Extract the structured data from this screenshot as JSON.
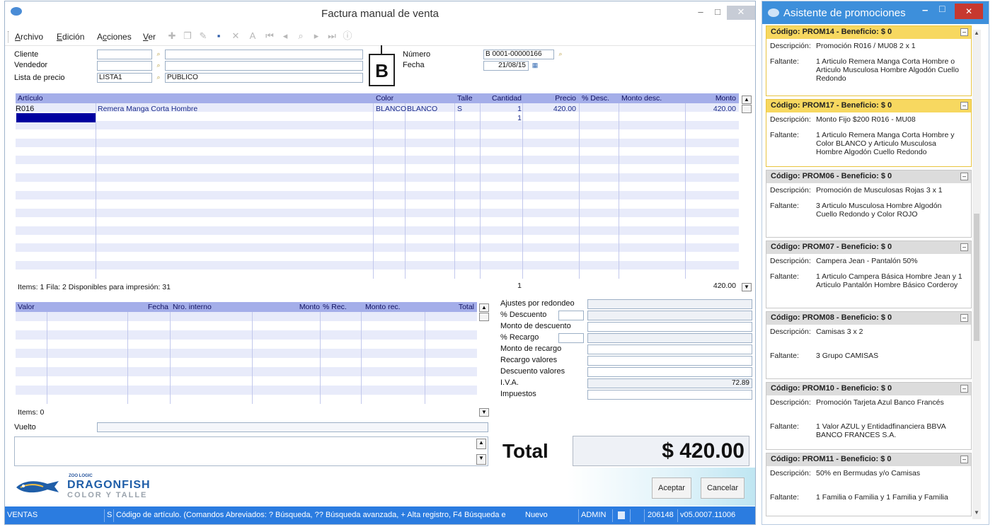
{
  "window": {
    "title": "Factura manual de venta",
    "minimize": "–",
    "maximize": "□",
    "close": "✕"
  },
  "menu": [
    {
      "label": "Archivo",
      "u": "A"
    },
    {
      "label": "Edición",
      "u": "E"
    },
    {
      "label": "Acciones",
      "u": "c"
    },
    {
      "label": "Ver",
      "u": "V"
    }
  ],
  "toolbar_icons": [
    "add-icon",
    "copy-icon",
    "edit-icon",
    "save-icon",
    "delete-icon",
    "font-icon",
    "first-icon",
    "prev-icon",
    "search-icon",
    "next-icon",
    "last-icon",
    "info-icon"
  ],
  "header": {
    "cliente_label": "Cliente",
    "vendedor_label": "Vendedor",
    "lista_label": "Lista de precio",
    "lista_code": "LISTA1",
    "lista_desc": "PUBLICO",
    "comprobante_letter": "B",
    "numero_label": "Número",
    "numero_value": "B 0001-00000166",
    "fecha_label": "Fecha",
    "fecha_value": "21/08/15"
  },
  "items_grid": {
    "columns": [
      "Artículo",
      "Color",
      "Talle",
      "Cantidad",
      "Precio",
      "% Desc.",
      "Monto desc.",
      "Monto"
    ],
    "rows": [
      {
        "articulo": "R016",
        "descripcion": "Remera Manga Corta Hombre",
        "color": "BLANCO",
        "color_desc": "BLANCO",
        "talle": "S",
        "cantidad": "1",
        "precio": "420.00",
        "monto": "420.00"
      },
      {
        "articulo": "",
        "descripcion": "",
        "color": "",
        "color_desc": "",
        "talle": "",
        "cantidad": "1",
        "precio": "",
        "monto": ""
      }
    ],
    "footer_info": "Items: 1   Fila: 2   Disponibles para impresión: 31",
    "footer_cantidad": "1",
    "footer_monto": "420.00"
  },
  "valores_grid": {
    "columns": [
      "Valor",
      "Fecha",
      "Nro. interno",
      "Monto",
      "% Rec.",
      "Monto rec.",
      "Total"
    ],
    "footer_info": "Items: 0"
  },
  "vuelto_label": "Vuelto",
  "totals": {
    "ajustes_label": "Ajustes por redondeo",
    "pct_desc_label": "% Descuento",
    "monto_desc_label": "Monto de descuento",
    "pct_rec_label": "% Recargo",
    "monto_rec_label": "Monto de recargo",
    "rec_valores_label": "Recargo valores",
    "desc_valores_label": "Descuento valores",
    "iva_label": "I.V.A.",
    "iva_value": "72.89",
    "impuestos_label": "Impuestos",
    "total_label": "Total",
    "total_value": "$ 420.00"
  },
  "brand": {
    "small": "ZOO LOGIC",
    "name": "DRAGONFISH",
    "sub": "COLOR Y TALLE"
  },
  "buttons": {
    "aceptar": "Aceptar",
    "cancelar": "Cancelar"
  },
  "status": {
    "module": "VENTAS",
    "s": "S",
    "hint": "Código de artículo. (Comandos Abreviados: ? Búsqueda, ?? Búsqueda avanzada, + Alta registro, F4 Búsqueda e",
    "mode": "Nuevo",
    "user": "ADMIN",
    "code": "206148",
    "version": "v05.0007.11006"
  },
  "side": {
    "title": "Asistente de promociones",
    "desc_label": "Descripción:",
    "faltante_label": "Faltante:",
    "promos": [
      {
        "codigo": "Código: PROM14 -  Beneficio: $ 0",
        "desc": "Promoción R016 / MU08 2 x 1",
        "faltante": "1 Articulo Remera Manga Corta Hombre  o Articulo Musculosa Hombre Algodón Cuello Redondo",
        "highlight": true
      },
      {
        "codigo": "Código: PROM17 -  Beneficio: $ 0",
        "desc": "Monto Fijo $200 R016 - MU08",
        "faltante": "1 Articulo Remera Manga Corta Hombre  y Color BLANCO  y Articulo Musculosa Hombre Algodón Cuello Redondo",
        "highlight": true
      },
      {
        "codigo": "Código: PROM06 -  Beneficio: $ 0",
        "desc": "Promoción de Musculosas Rojas 3 x 1",
        "faltante": "3 Articulo Musculosa Hombre Algodón Cuello Redondo  y Color ROJO",
        "highlight": false
      },
      {
        "codigo": "Código: PROM07 -  Beneficio: $ 0",
        "desc": "Campera Jean - Pantalón 50%",
        "faltante": "1 Articulo Campera Básica Hombre Jean y 1 Articulo Pantalón Hombre Básico Corderoy",
        "highlight": false
      },
      {
        "codigo": "Código: PROM08 -  Beneficio: $ 0",
        "desc": "Camisas 3 x 2",
        "faltante": "3 Grupo CAMISAS",
        "highlight": false
      },
      {
        "codigo": "Código: PROM10 -  Beneficio: $ 0",
        "desc": "Promoción Tarjeta Azul Banco Francés",
        "faltante": "1 Valor AZUL  y Entidadfinanciera BBVA BANCO FRANCES S.A.",
        "highlight": false
      },
      {
        "codigo": "Código: PROM11 -  Beneficio: $ 0",
        "desc": "50% en Bermudas y/o Camisas",
        "faltante": "1 Familia  o Familia y 1 Familia  y Familia",
        "highlight": false
      }
    ]
  },
  "colors": {
    "accent": "#3d8fdb",
    "grid_header": "#a4aee9",
    "highlight": "#f7d860",
    "status": "#2b7ce0"
  }
}
